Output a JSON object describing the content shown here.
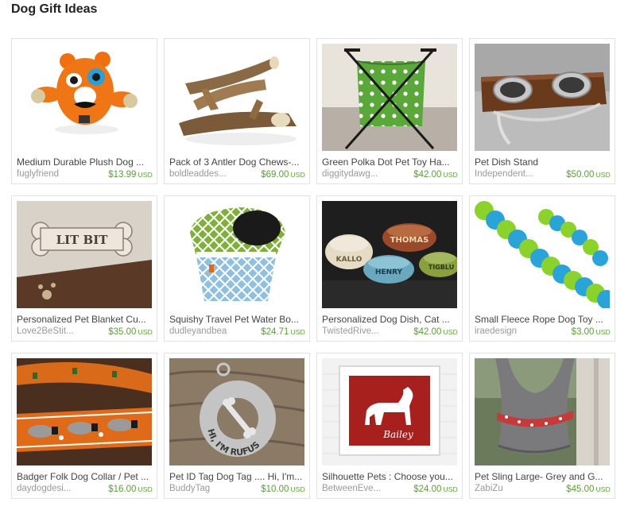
{
  "page": {
    "title": "Dog Gift Ideas"
  },
  "items": [
    {
      "title": "Medium Durable Plush Dog ...",
      "shop": "fuglyfriend",
      "price": "$13.99",
      "currency": "USD",
      "image": "orange-plush-toy"
    },
    {
      "title": "Pack of 3 Antler Dog Chews-...",
      "shop": "boldleaddes...",
      "price": "$69.00",
      "currency": "USD",
      "image": "antler-chews"
    },
    {
      "title": "Green Polka Dot Pet Toy Ha...",
      "shop": "diggitydawg...",
      "price": "$42.00",
      "currency": "USD",
      "image": "polka-dot-hamper"
    },
    {
      "title": "Pet Dish Stand",
      "shop": "Independent...",
      "price": "$50.00",
      "currency": "USD",
      "image": "dish-stand"
    },
    {
      "title": "Personalized Pet Blanket Cu...",
      "shop": "Love2BeStit...",
      "price": "$35.00",
      "currency": "USD",
      "image": "embroidered-blanket"
    },
    {
      "title": "Squishy Travel Pet Water Bo...",
      "shop": "dudleyandbea",
      "price": "$24.71",
      "currency": "USD",
      "image": "travel-bowl"
    },
    {
      "title": "Personalized Dog Dish, Cat ...",
      "shop": "TwistedRive...",
      "price": "$42.00",
      "currency": "USD",
      "image": "ceramic-dishes"
    },
    {
      "title": "Small Fleece Rope Dog Toy ...",
      "shop": "iraedesign",
      "price": "$3.00",
      "currency": "USD",
      "image": "fleece-rope"
    },
    {
      "title": "Badger Folk Dog Collar / Pet ...",
      "shop": "daydogdesi...",
      "price": "$16.00",
      "currency": "USD",
      "image": "badger-collar"
    },
    {
      "title": "Pet ID Tag Dog Tag .... Hi, I'm...",
      "shop": "BuddyTag",
      "price": "$10.00",
      "currency": "USD",
      "image": "id-tag"
    },
    {
      "title": "Silhouette Pets : Choose you...",
      "shop": "BetweenEve...",
      "price": "$24.00",
      "currency": "USD",
      "image": "silhouette-print"
    },
    {
      "title": "Pet Sling Large- Grey and G...",
      "shop": "ZabiZu",
      "price": "$45.00",
      "currency": "USD",
      "image": "pet-sling"
    }
  ],
  "image_text": {
    "blanket": "LIT BIT",
    "dish_1": "KALLO",
    "dish_2": "THOMAS",
    "dish_3": "HENRY",
    "dish_4": "TIGBLU",
    "tag": "HI, I'M RUFUS",
    "print": "Bailey"
  },
  "colors": {
    "price": "#5aa236",
    "shop": "#9a9a9a",
    "title": "#444444",
    "border": "#e2e2e2"
  }
}
